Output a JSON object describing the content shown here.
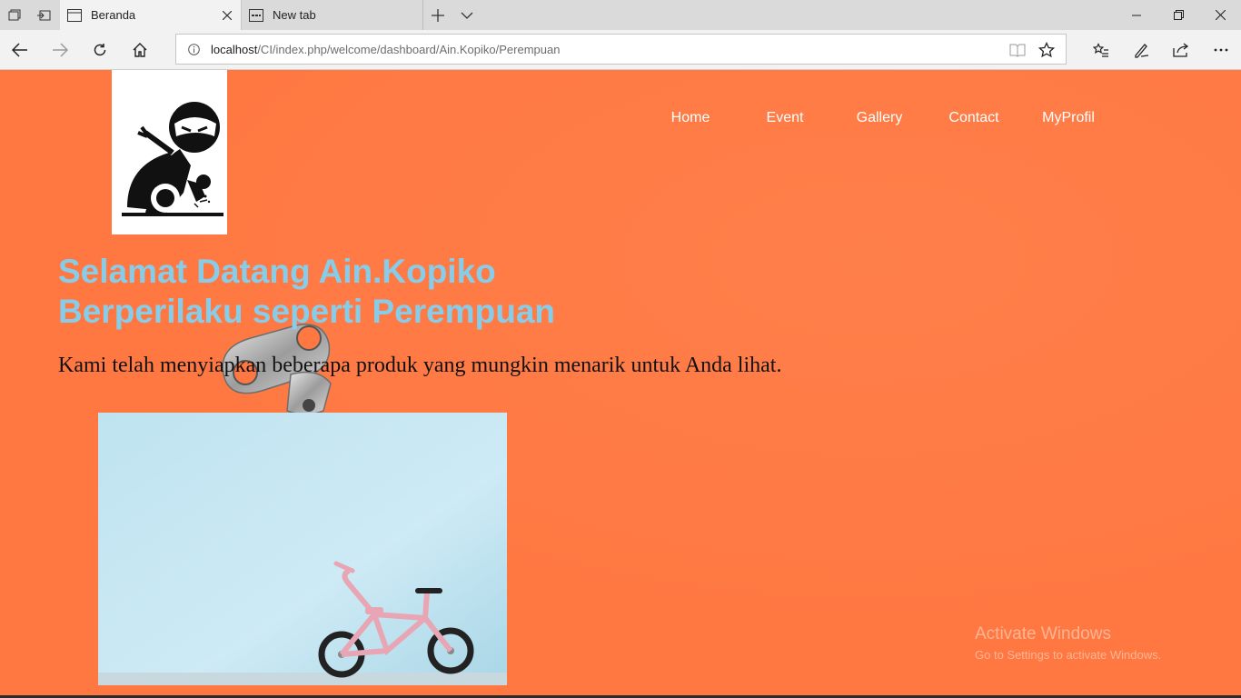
{
  "browser": {
    "tabs": [
      {
        "title": "Beranda",
        "active": true
      },
      {
        "title": "New tab",
        "active": false
      }
    ],
    "address": {
      "host": "localhost",
      "path": "/CI/index.php/welcome/dashboard/Ain.Kopiko/Perempuan"
    },
    "icons": [
      "tab-preview-icon",
      "set-aside-tabs-icon",
      "page-icon",
      "close-icon",
      "new-tab-icon",
      "tab-list-icon",
      "minimize-icon",
      "maximize-icon",
      "window-close-icon",
      "back-icon",
      "forward-icon",
      "refresh-icon",
      "home-icon",
      "info-icon",
      "reading-view-icon",
      "favorite-star-icon",
      "favorites-hub-icon",
      "pen-icon",
      "share-icon",
      "more-icon"
    ]
  },
  "site": {
    "menu": [
      "Home",
      "Event",
      "Gallery",
      "Contact",
      "MyProfil"
    ],
    "heading_line1": "Selamat Datang Ain.Kopiko",
    "heading_line2": "Berperilaku seperti Perempuan",
    "subtitle": "Kami telah menyiapkan beberapa produk yang mungkin menarik untuk Anda lihat.",
    "colors": {
      "background": "#ff7842",
      "heading": "#87cdea",
      "menu_text": "#ffffff"
    }
  },
  "os": {
    "watermark_title": "Activate Windows",
    "watermark_sub": "Go to Settings to activate Windows."
  }
}
